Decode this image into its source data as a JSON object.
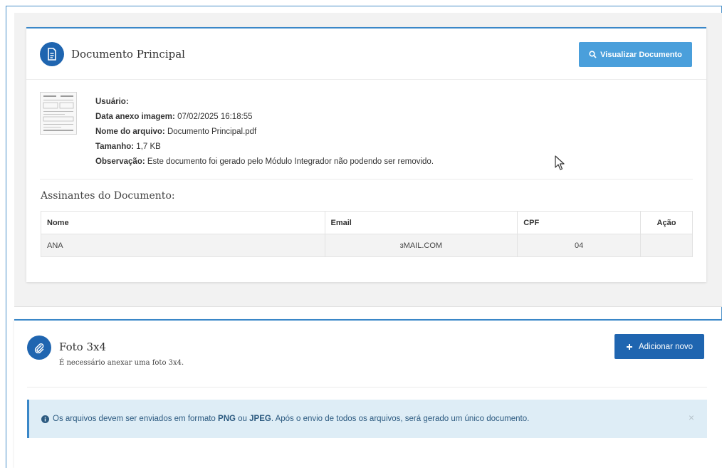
{
  "document_card": {
    "title": "Documento Principal",
    "view_button_label": "Visualizar Documento",
    "meta": {
      "user_label": "Usuário:",
      "user_value": "",
      "date_label": "Data anexo imagem:",
      "date_value": "07/02/2025 16:18:55",
      "filename_label": "Nome do arquivo:",
      "filename_value": "Documento Principal.pdf",
      "size_label": "Tamanho:",
      "size_value": "1,7 KB",
      "note_label": "Observação:",
      "note_value": "Este documento foi gerado pelo Módulo Integrador não podendo ser removido."
    },
    "signers_title": "Assinantes do Documento:",
    "signers_table": {
      "headers": [
        "Nome",
        "Email",
        "CPF",
        "Ação"
      ],
      "rows": [
        [
          "ANA",
          "ɜMAIL.COM",
          "04",
          ""
        ]
      ]
    }
  },
  "photo_card": {
    "title": "Foto 3x4",
    "subtitle": "É necessário anexar uma foto 3x4.",
    "add_button_label": "Adicionar novo",
    "alert": {
      "text_1": "Os arquivos devem ser enviados em formato ",
      "fmt_png": "PNG",
      "text_2": " ou ",
      "fmt_jpeg": "JPEG",
      "text_3": ". Após o envio de todos os arquivos, será gerado um único documento.",
      "close_glyph": "×"
    }
  },
  "colors": {
    "primary": "#1f65b0",
    "info_button": "#4a9fdb",
    "alert_bg": "#deedf6",
    "border_accent": "#3a87c8"
  },
  "icons": [
    "document-icon",
    "search-icon",
    "paperclip-icon",
    "plus-icon",
    "info-icon",
    "close-icon",
    "mouse-cursor-icon"
  ]
}
